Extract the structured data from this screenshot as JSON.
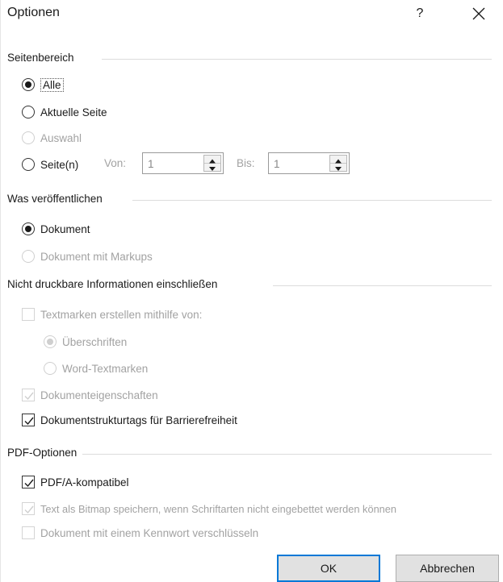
{
  "window": {
    "title": "Optionen",
    "help_label": "?",
    "close_label": "Schließen"
  },
  "page_range": {
    "header": "Seitenbereich",
    "options": [
      {
        "label": "Alle",
        "checked": true,
        "enabled": true
      },
      {
        "label": "Aktuelle Seite",
        "checked": false,
        "enabled": true
      },
      {
        "label": "Auswahl",
        "checked": false,
        "enabled": false
      },
      {
        "label": "Seite(n)",
        "checked": false,
        "enabled": true
      }
    ],
    "from_label": "Von:",
    "from_value": "1",
    "to_label": "Bis:",
    "to_value": "1"
  },
  "publish": {
    "header": "Was veröffentlichen",
    "options": [
      {
        "label": "Dokument",
        "checked": true,
        "enabled": true
      },
      {
        "label": "Dokument mit Markups",
        "checked": false,
        "enabled": false
      }
    ]
  },
  "nonprint": {
    "header": "Nicht druckbare Informationen einschließen",
    "bookmarks_label": "Textmarken erstellen mithilfe von:",
    "bookmark_options": [
      {
        "label": "Überschriften",
        "checked": true,
        "enabled": false
      },
      {
        "label": "Word-Textmarken",
        "checked": false,
        "enabled": false
      }
    ],
    "doc_props_label": "Dokumenteigenschaften",
    "struct_tags_label": "Dokumentstrukturtags für Barrierefreiheit"
  },
  "pdf": {
    "header": "PDF-Optionen",
    "pdfa_label": "PDF/A-kompatibel",
    "bitmap_label": "Text als Bitmap speichern, wenn Schriftarten nicht eingebettet werden können",
    "encrypt_label": "Dokument mit einem Kennwort verschlüsseln"
  },
  "buttons": {
    "ok": "OK",
    "cancel": "Abbrechen"
  },
  "colors": {
    "accent": "#0078d7",
    "disabled_text": "#a2a2a2"
  }
}
